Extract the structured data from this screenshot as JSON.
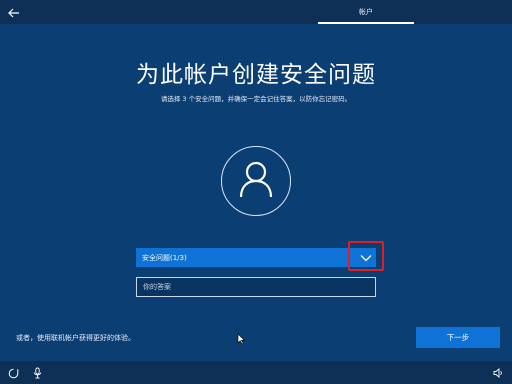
{
  "header": {
    "back_icon": "arrow-left-icon",
    "step_tab": "帐户"
  },
  "main": {
    "title": "为此帐户创建安全问题",
    "subtitle": "请选择 3 个安全问题，并确保一定会记住答案，以防你忘记密码。",
    "avatar_icon": "user-icon",
    "question_select": {
      "selected": "安全问题(1/3)",
      "chevron_icon": "chevron-down-icon"
    },
    "answer_input": {
      "placeholder": "你的答案",
      "value": ""
    }
  },
  "footer": {
    "alt_link": "或者，使用联机帐户获得更好的体验。",
    "next_button": "下一步"
  },
  "taskbar": {
    "icons": [
      "ease-of-access-icon",
      "microphone-icon",
      "volume-icon"
    ]
  },
  "colors": {
    "background": "#0b3f73",
    "bar": "#0e2f56",
    "accent": "#0f72d6",
    "highlight": "#e02020"
  }
}
